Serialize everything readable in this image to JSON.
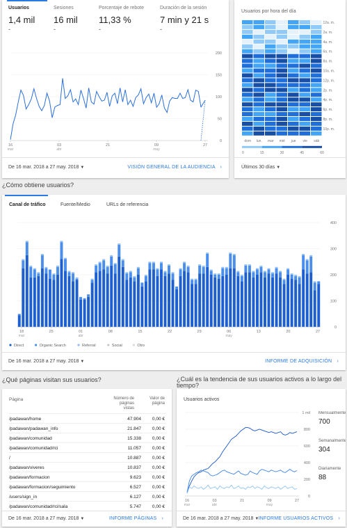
{
  "overview": {
    "metrics": [
      {
        "label": "Usuarios",
        "value": "1,4 mil",
        "sub": "-"
      },
      {
        "label": "Sesiones",
        "value": "16 mil",
        "sub": "-"
      },
      {
        "label": "Porcentaje de rebote",
        "value": "11,33 %",
        "sub": "-"
      },
      {
        "label": "Duración de la sesión",
        "value": "7 min y 21 s",
        "sub": "-"
      }
    ],
    "footer_date": "De 16 mar. 2018 a 27 may. 2018",
    "footer_link": "VISIÓN GENERAL DE LA AUDIENCIA"
  },
  "users_line_chart": {
    "type": "line",
    "y_ticks": [
      "200",
      "150",
      "100",
      "50",
      "0"
    ],
    "ylim": [
      0,
      200
    ],
    "x_ticks": [
      {
        "day": "16",
        "month": "mar"
      },
      {
        "day": "03",
        "month": "abr"
      },
      {
        "day": "21",
        "month": ""
      },
      {
        "day": "09",
        "month": "may"
      },
      {
        "day": "27",
        "month": ""
      }
    ],
    "values": [
      2,
      38,
      58,
      88,
      115,
      103,
      72,
      82,
      95,
      118,
      96,
      78,
      68,
      80,
      108,
      90,
      52,
      76,
      80,
      82,
      142,
      96,
      102,
      116,
      88,
      95,
      82,
      115,
      96,
      74,
      120,
      88,
      83,
      112,
      100,
      90,
      92,
      110,
      78,
      102,
      108,
      84,
      120,
      88,
      116,
      82,
      92,
      78,
      98,
      104,
      118,
      84,
      98,
      106,
      86,
      108,
      76,
      84,
      104,
      74,
      64,
      90,
      98,
      96,
      96,
      108,
      96,
      98,
      116,
      92,
      88,
      115,
      112,
      76,
      92
    ]
  },
  "heatmap": {
    "title": "Usuarios por hora del día",
    "hour_labels": [
      "12a. m.",
      "2a. m.",
      "4a. m.",
      "6a. m.",
      "8a. m.",
      "10a. m.",
      "12p. m.",
      "2p. m.",
      "4p. m.",
      "6p. m.",
      "8p. m.",
      "10p. m."
    ],
    "day_labels": [
      "dom",
      "lun.",
      "mar",
      "mié",
      "jue",
      "vie",
      "sáb"
    ],
    "scale_labels": [
      "0",
      "15",
      "30",
      "45",
      "60"
    ],
    "colors": [
      "#e3f2fd",
      "#90caf9",
      "#42a5f5",
      "#1e6fd9",
      "#174ea6"
    ],
    "footer": "Últimos 30 días"
  },
  "acquisition": {
    "section_title": "¿Cómo obtiene usuarios?",
    "tabs": [
      "Canal de tráfico",
      "Fuente/Medio",
      "URLs de referencia"
    ],
    "footer_date": "De 16 mar. 2018 a 27 may. 2018",
    "footer_link": "INFORME DE ADQUISICIÓN"
  },
  "acquisition_chart": {
    "type": "bar",
    "stacked": true,
    "y_ticks": [
      "400",
      "300",
      "200",
      "100",
      "0"
    ],
    "ylim": [
      0,
      400
    ],
    "x_ticks": [
      {
        "day": "18",
        "month": "mar"
      },
      {
        "day": "25",
        "month": ""
      },
      {
        "day": "01",
        "month": "abr"
      },
      {
        "day": "08",
        "month": ""
      },
      {
        "day": "15",
        "month": ""
      },
      {
        "day": "22",
        "month": ""
      },
      {
        "day": "29",
        "month": ""
      },
      {
        "day": "06",
        "month": "may"
      },
      {
        "day": "13",
        "month": ""
      },
      {
        "day": "20",
        "month": ""
      },
      {
        "day": "27",
        "month": ""
      }
    ],
    "series": [
      {
        "name": "Direct",
        "color": "#1e5fd0",
        "values": [
          45,
          225,
          275,
          190,
          190,
          195,
          225,
          205,
          185,
          180,
          200,
          260,
          215,
          195,
          175,
          180,
          105,
          105,
          115,
          170,
          210,
          215,
          220,
          205,
          235,
          205,
          270,
          230,
          180,
          190,
          175,
          200,
          155,
          175,
          220,
          220,
          195,
          220,
          195,
          205,
          180,
          145,
          195,
          215,
          210,
          165,
          165,
          205,
          205,
          230,
          200,
          190,
          185,
          195,
          200,
          225,
          225,
          195,
          175,
          210,
          210,
          190,
          200,
          210,
          190,
          205,
          190,
          205,
          190,
          165,
          200,
          185,
          180,
          165,
          220,
          205,
          210,
          140,
          165
        ]
      },
      {
        "name": "Organic Search",
        "color": "#4b8eeb",
        "values": [
          5,
          30,
          50,
          40,
          30,
          10,
          50,
          20,
          35,
          20,
          30,
          65,
          45,
          15,
          30,
          5,
          10,
          5,
          10,
          10,
          25,
          30,
          35,
          25,
          35,
          35,
          45,
          25,
          25,
          20,
          15,
          25,
          15,
          20,
          25,
          25,
          25,
          25,
          15,
          30,
          25,
          10,
          25,
          30,
          20,
          15,
          15,
          30,
          25,
          50,
          15,
          10,
          15,
          30,
          25,
          55,
          50,
          15,
          20,
          25,
          25,
          20,
          20,
          20,
          20,
          15,
          15,
          20,
          20,
          15,
          20,
          15,
          15,
          25,
          55,
          50,
          60,
          30,
          10
        ]
      },
      {
        "name": "Referral",
        "color": "#90c0f5",
        "values": [
          0,
          5,
          5,
          5,
          5,
          5,
          5,
          5,
          0,
          5,
          5,
          5,
          5,
          5,
          5,
          5,
          0,
          0,
          0,
          5,
          5,
          5,
          5,
          5,
          5,
          5,
          5,
          5,
          5,
          5,
          5,
          5,
          0,
          5,
          5,
          5,
          5,
          5,
          5,
          5,
          5,
          0,
          5,
          5,
          5,
          5,
          5,
          5,
          5,
          5,
          5,
          5,
          5,
          5,
          5,
          5,
          5,
          5,
          5,
          5,
          5,
          5,
          5,
          5,
          5,
          5,
          5,
          5,
          5,
          5,
          5,
          5,
          5,
          5,
          5,
          5,
          5,
          5,
          0
        ]
      },
      {
        "name": "Social",
        "color": "#c7c7c7",
        "values": []
      },
      {
        "name": "Otro",
        "color": "#d9d9d9",
        "values": []
      }
    ]
  },
  "pages": {
    "section_title": "¿Qué páginas visitan sus usuarios?",
    "col_page": "Página",
    "col_views_1": "Número de",
    "col_views_2": "páginas",
    "col_views_3": "vistas",
    "col_value_1": "Valor de",
    "col_value_2": "página",
    "rows": [
      {
        "page": "/padawan/home",
        "views": "47.904",
        "value": "0,00 €"
      },
      {
        "page": "/padawan/padawan_info",
        "views": "21.847",
        "value": "0,00 €"
      },
      {
        "page": "/padawan/comunidad",
        "views": "15.338",
        "value": "0,00 €"
      },
      {
        "page": "/padawan/comunidad/rci",
        "views": "11.057",
        "value": "0,00 €"
      },
      {
        "page": "/",
        "views": "10.887",
        "value": "0,00 €"
      },
      {
        "page": "/padawan/viveres",
        "views": "10.837",
        "value": "0,00 €"
      },
      {
        "page": "/padawan/formacion",
        "views": "9.623",
        "value": "0,00 €"
      },
      {
        "page": "/padawan/formacion/seguimiento",
        "views": "6.527",
        "value": "0,00 €"
      },
      {
        "page": "/users/sign_in",
        "views": "6.127",
        "value": "0,00 €"
      },
      {
        "page": "/padawan/comunidad/rci/sala",
        "views": "5.747",
        "value": "0,00 €"
      }
    ],
    "footer_date": "De 16 mar. 2018 a 27 may. 2018",
    "footer_link": "INFORME PÁGINAS"
  },
  "active": {
    "section_title_1": "¿Cuál es la tendencia de sus usuarios activos a lo largo del",
    "section_title_2": "tiempo?",
    "card_title": "Usuarios activos",
    "legend": [
      {
        "label": "Mensualmente",
        "value": "700"
      },
      {
        "label": "Semanalmente",
        "value": "304"
      },
      {
        "label": "Diariamente",
        "value": "88"
      }
    ],
    "footer_date": "De 16 mar. 2018 a 27 may. 2018",
    "footer_link": "INFORME USUARIOS ACTIVOS"
  },
  "active_chart": {
    "type": "line",
    "y_ticks": [
      "1 mil",
      "800",
      "600",
      "400",
      "200",
      "0"
    ],
    "ylim": [
      0,
      1000
    ],
    "x_ticks": [
      {
        "day": "16",
        "month": "mar"
      },
      {
        "day": "03",
        "month": "abr"
      },
      {
        "day": "21",
        "month": ""
      },
      {
        "day": "09",
        "month": "may"
      },
      {
        "day": "27",
        "month": ""
      }
    ],
    "series": [
      {
        "name": "Mensualmente",
        "color": "#1a57c6",
        "values": [
          50,
          120,
          180,
          230,
          260,
          280,
          290,
          310,
          320,
          330,
          360,
          390,
          410,
          440,
          470,
          520,
          560,
          600,
          640,
          680,
          700,
          720,
          750,
          780,
          800,
          820,
          820,
          810,
          790,
          780,
          790,
          800,
          790,
          780,
          770,
          760,
          770,
          760,
          750,
          760,
          770,
          740,
          730,
          740,
          760,
          750,
          760,
          770
        ]
      },
      {
        "name": "Semanalmente",
        "color": "#3f84e8",
        "values": [
          40,
          180,
          240,
          260,
          280,
          290,
          310,
          300,
          290,
          280,
          250,
          240,
          250,
          260,
          280,
          300,
          310,
          290,
          280,
          270,
          260,
          280,
          300,
          270,
          260,
          250,
          260,
          300,
          280,
          270,
          260,
          300,
          320,
          310,
          300,
          290,
          310,
          300,
          290,
          300,
          310,
          290,
          280,
          300,
          320,
          300,
          290,
          304
        ]
      },
      {
        "name": "Diariamente",
        "color": "#8fc3f2",
        "values": [
          30,
          110,
          90,
          120,
          100,
          90,
          110,
          80,
          100,
          130,
          90,
          100,
          110,
          80,
          120,
          100,
          90,
          110,
          100,
          130,
          90,
          100,
          120,
          90,
          100,
          80,
          110,
          100,
          120,
          90,
          110,
          100,
          80,
          120,
          100,
          90,
          110,
          100,
          90,
          110,
          80,
          100,
          120,
          90,
          100,
          110,
          80,
          88
        ]
      }
    ]
  },
  "chart_data": [
    {
      "type": "line",
      "ref": "users_line_chart"
    },
    {
      "type": "heatmap",
      "ref": "heatmap"
    },
    {
      "type": "bar",
      "ref": "acquisition_chart"
    },
    {
      "type": "line",
      "ref": "active_chart"
    }
  ]
}
